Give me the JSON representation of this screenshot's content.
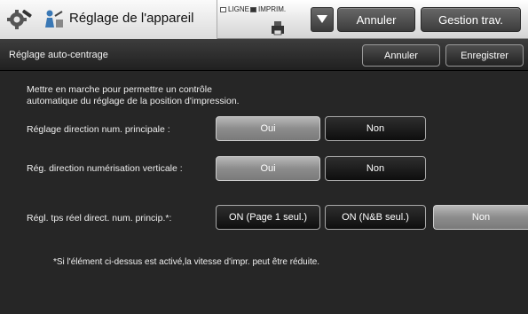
{
  "header": {
    "title": "Réglage de l'appareil",
    "status_ligne": "LIGNE",
    "status_imprim": "IMPRIM.",
    "cancel_label": "Annuler",
    "job_status_label": "Gestion trav."
  },
  "subheader": {
    "title": "Réglage auto-centrage",
    "cancel_label": "Annuler",
    "save_label": "Enregistrer"
  },
  "content": {
    "description_line1": "Mettre en marche pour permettre un contrôle",
    "description_line2": "automatique du réglage de la position d'impression.",
    "rows": [
      {
        "label": "Réglage direction num. principale :",
        "options": [
          "Oui",
          "Non"
        ],
        "selected": "Oui"
      },
      {
        "label": "Rég. direction numérisation verticale :",
        "options": [
          "Oui",
          "Non"
        ],
        "selected": "Oui"
      },
      {
        "label": "Régl. tps réel direct. num. princip.*:",
        "options": [
          "ON (Page 1 seul.)",
          "ON (N&B seul.)",
          "Non"
        ],
        "selected": "Non"
      }
    ],
    "note": "*Si l'élément ci-dessus est activé,la vitesse d'impr. peut être réduite."
  },
  "icons": {
    "app": "gear-wrench-icon",
    "setting": "person-pointer-icon",
    "printer": "printer-icon",
    "dropdown": "triangle-down-icon"
  },
  "colors": {
    "header_bg": "#e8e8e8",
    "content_bg": "#262626",
    "selected_button": "#9a9a9a",
    "unselected_button": "#111111"
  }
}
